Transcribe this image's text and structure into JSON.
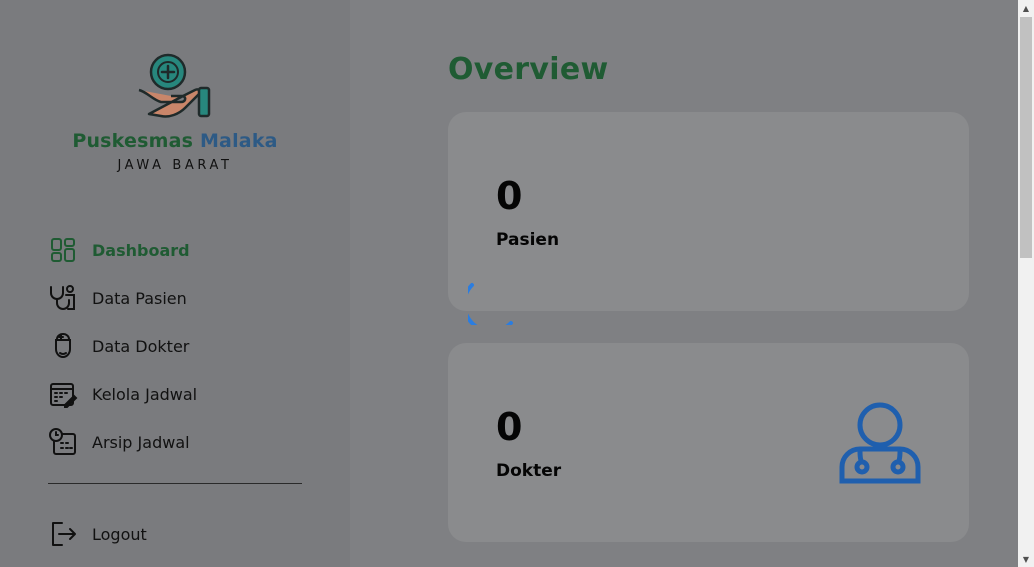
{
  "brand": {
    "name_part1": "Puskesmas",
    "name_part2": "Malaka",
    "region": "JAWA BARAT",
    "primary_color": "#1f5b33",
    "secondary_color": "#2d5a85"
  },
  "sidebar": {
    "items": [
      {
        "label": "Dashboard",
        "icon": "dashboard-grid-icon",
        "active": true
      },
      {
        "label": "Data Pasien",
        "icon": "stethoscope-icon",
        "active": false
      },
      {
        "label": "Data Dokter",
        "icon": "doctor-head-icon",
        "active": false
      },
      {
        "label": "Kelola Jadwal",
        "icon": "calendar-edit-icon",
        "active": false
      },
      {
        "label": "Arsip Jadwal",
        "icon": "calendar-clock-icon",
        "active": false
      }
    ],
    "logout_label": "Logout"
  },
  "main": {
    "title": "Overview",
    "cards": [
      {
        "value": "0",
        "label": "Pasien"
      },
      {
        "value": "0",
        "label": "Dokter",
        "icon": "doctor-icon"
      }
    ]
  },
  "colors": {
    "spinner": "#2b7de0",
    "doctor_icon": "#1f5fae"
  }
}
